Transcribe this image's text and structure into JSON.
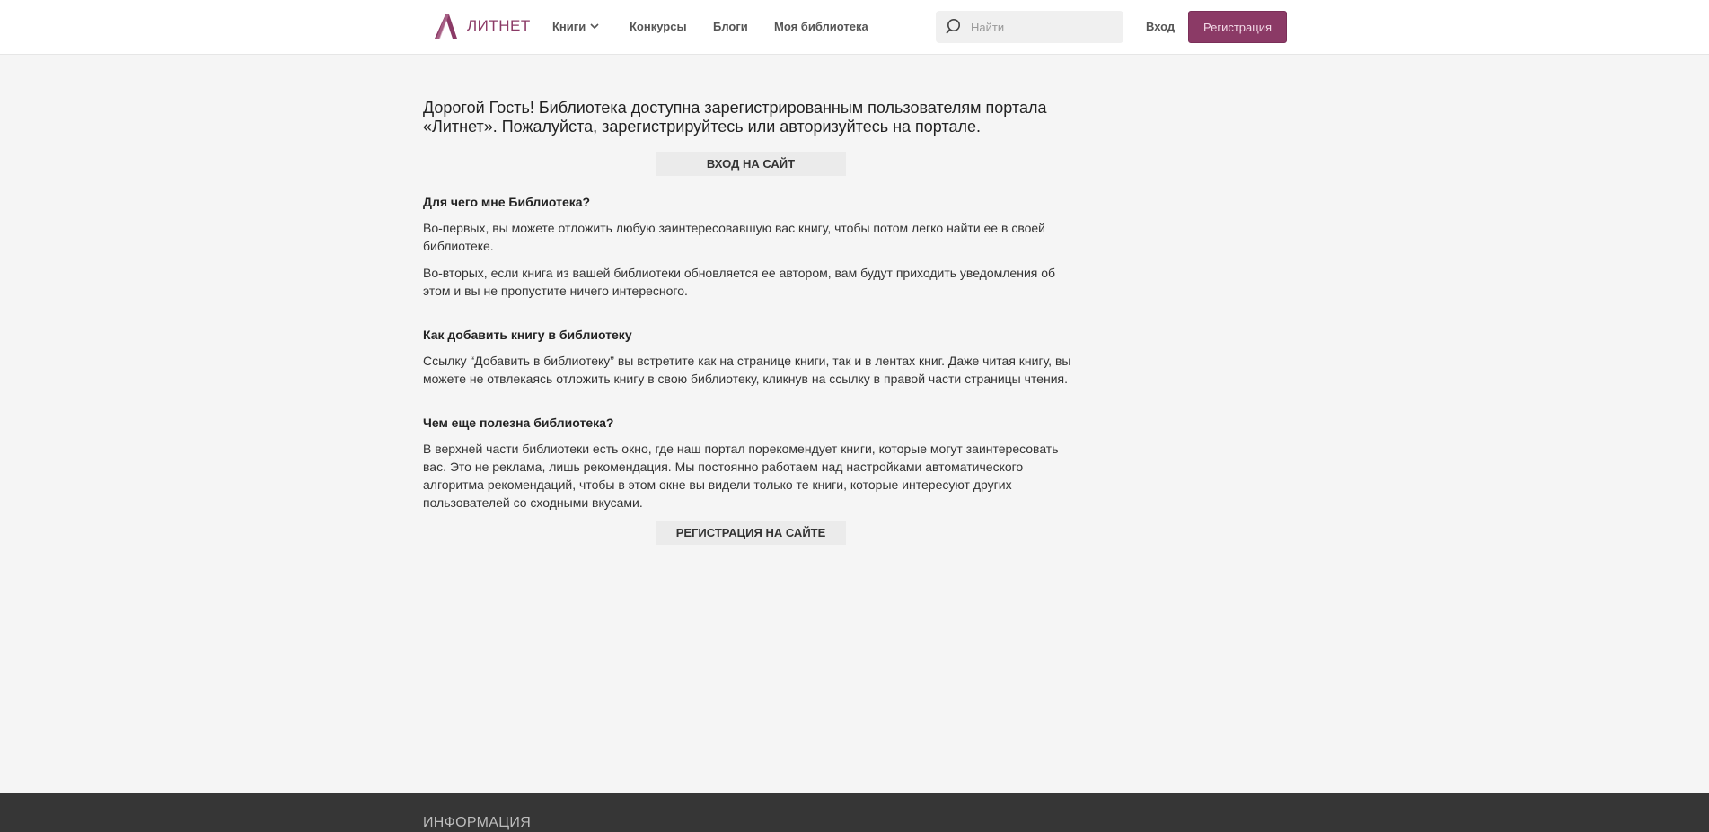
{
  "header": {
    "logo_text": "ЛИТНЕТ",
    "nav": {
      "books": "Книги",
      "contests": "Конкурсы",
      "blogs": "Блоги",
      "library": "Моя библиотека"
    },
    "search_placeholder": "Найти",
    "login": "Вход",
    "register": "Регистрация"
  },
  "main": {
    "intro": "Дорогой Гость! Библиотека доступна зарегистрированным пользователям портала «Литнет». Пожалуйста, зарегистрируйтесь или авторизуйтесь на портале.",
    "login_button": "ВХОД НА САЙТ",
    "sections": [
      {
        "title": "Для чего мне Библиотека?",
        "paragraphs": [
          "Во-первых, вы можете отложить любую заинтересовавшую вас книгу, чтобы потом легко найти ее в своей библиотеке.",
          "Во-вторых, если книга из вашей библиотеки обновляется ее автором, вам будут приходить уведомления об этом и вы не пропустите ничего интересного."
        ]
      },
      {
        "title": "Как добавить книгу в библиотеку",
        "paragraphs": [
          "Ссылку “Добавить в библиотеку” вы встретите как на странице книги, так и в лентах книг. Даже читая книгу, вы можете не отвлекаясь отложить книгу в свою библиотеку, кликнув на ссылку в правой части страницы чтения."
        ]
      },
      {
        "title": "Чем еще полезна библиотека?",
        "paragraphs": [
          "В верхней части библиотеки есть окно, где наш портал порекомендует книги, которые могут заинтересовать вас. Это не реклама, лишь рекомендация. Мы постоянно работаем над настройками автоматического алгоритма рекомендаций, чтобы в этом окне вы видели только те книги, которые интересуют других пользователей со сходными вкусами."
        ]
      }
    ],
    "register_button": "РЕГИСТРАЦИЯ НА САЙТЕ"
  },
  "footer": {
    "title": "ИНФОРМАЦИЯ"
  },
  "colors": {
    "brand": "#8b3a66",
    "background": "#f5f5f5",
    "footer": "#363636"
  },
  "icons": {
    "logo": "litnet-logo-icon",
    "dropdown": "chevron-down-icon",
    "search": "search-icon"
  }
}
